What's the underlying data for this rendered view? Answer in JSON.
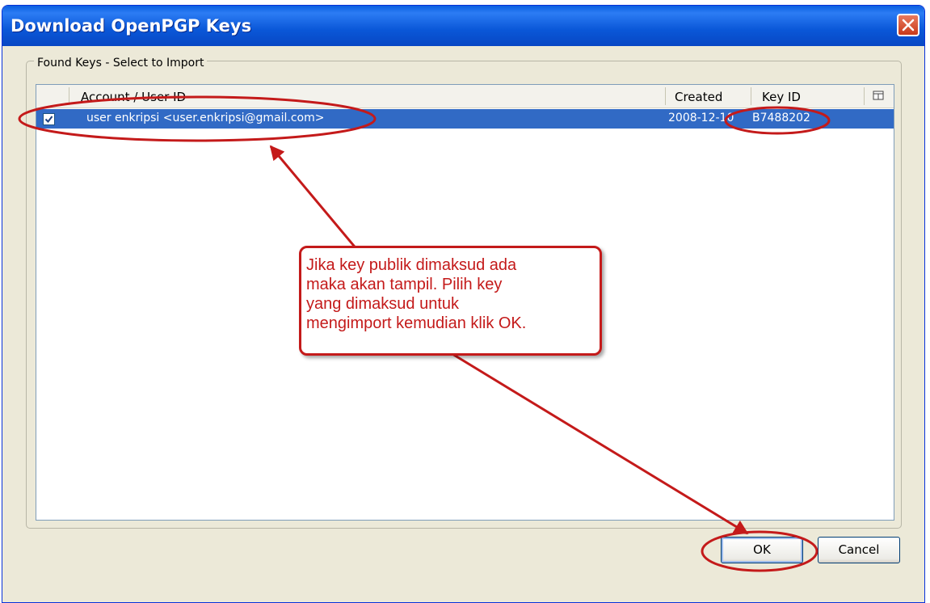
{
  "window": {
    "title": "Download OpenPGP Keys"
  },
  "group": {
    "legend": "Found Keys - Select to Import"
  },
  "table": {
    "columns": {
      "account": "Account / User ID",
      "created": "Created",
      "key_id": "Key ID"
    },
    "rows": [
      {
        "checked": true,
        "account": "user enkripsi <user.enkripsi@gmail.com>",
        "created": "2008-12-10",
        "key_id": "B7488202"
      }
    ]
  },
  "annotation": {
    "text": "Jika key publik dimaksud ada\nmaka akan tampil. Pilih key\nyang dimaksud untuk\nmengimport kemudian klik OK.",
    "color": "#c41a1a"
  },
  "buttons": {
    "ok": "OK",
    "cancel": "Cancel"
  },
  "icons": {
    "close": "close-icon",
    "column_picker": "column-picker-icon",
    "checkbox": "checkbox-icon"
  }
}
